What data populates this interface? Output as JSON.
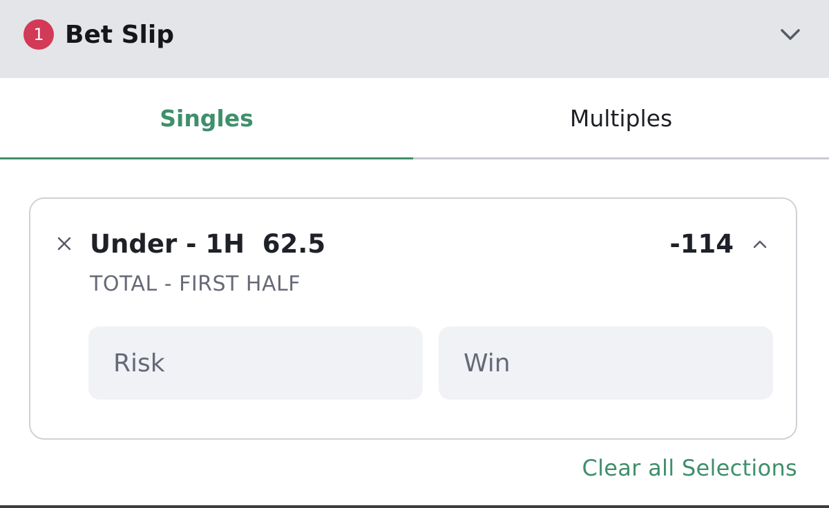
{
  "colors": {
    "accent_green": "#3f8f6b",
    "badge_red": "#d23a57",
    "header_bg": "#e4e5e9",
    "field_bg": "#f1f2f6"
  },
  "header": {
    "badge_count": "1",
    "title": "Bet Slip",
    "collapse_icon": "chevron-down-icon"
  },
  "tabs": [
    {
      "label": "Singles",
      "active": true
    },
    {
      "label": "Multiples",
      "active": false
    }
  ],
  "selection": {
    "remove_icon": "close-icon",
    "name": "Under - 1H  62.5",
    "market": "TOTAL - FIRST HALF",
    "odds": "-114",
    "expand_icon": "chevron-up-icon",
    "risk_placeholder": "Risk",
    "win_placeholder": "Win"
  },
  "footer": {
    "clear_all_label": "Clear all Selections"
  }
}
